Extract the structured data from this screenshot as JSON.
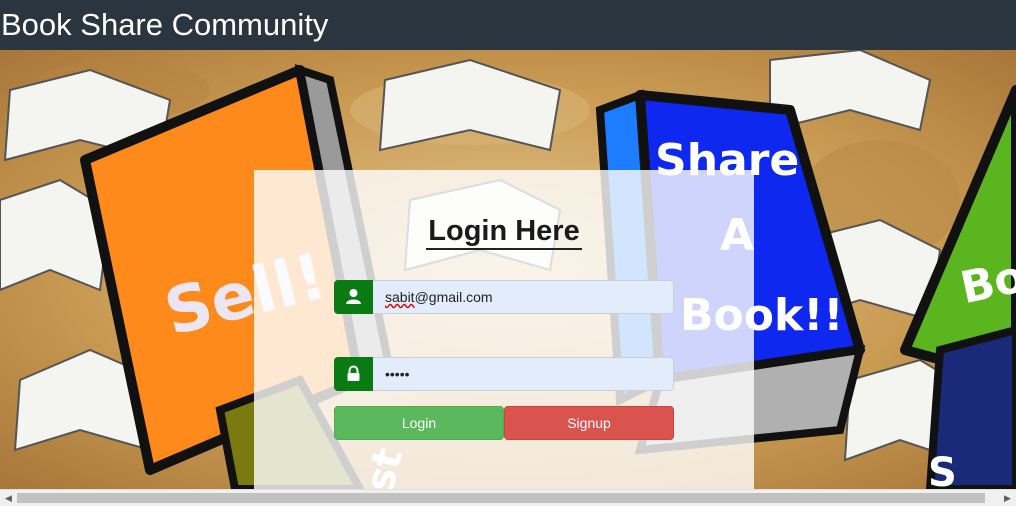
{
  "header": {
    "title": "Book Share Community"
  },
  "background": {
    "book_labels": [
      "Sell!",
      "Share",
      "A",
      "Book!!",
      "Bo",
      "st",
      "S"
    ]
  },
  "login": {
    "heading": "Login Here",
    "email_prefix_underlined": "sabit",
    "email_rest": "@gmail.com",
    "password_masked": "•••••",
    "login_label": "Login",
    "signup_label": "Signup"
  },
  "icons": {
    "email_addon": "user-icon",
    "password_addon": "lock-icon"
  },
  "colors": {
    "header_bg": "#2b3540",
    "addon_green": "#0a7a12",
    "login_green": "#5cb85c",
    "signup_red": "#d9534f",
    "input_bg": "#e2ecfa"
  }
}
